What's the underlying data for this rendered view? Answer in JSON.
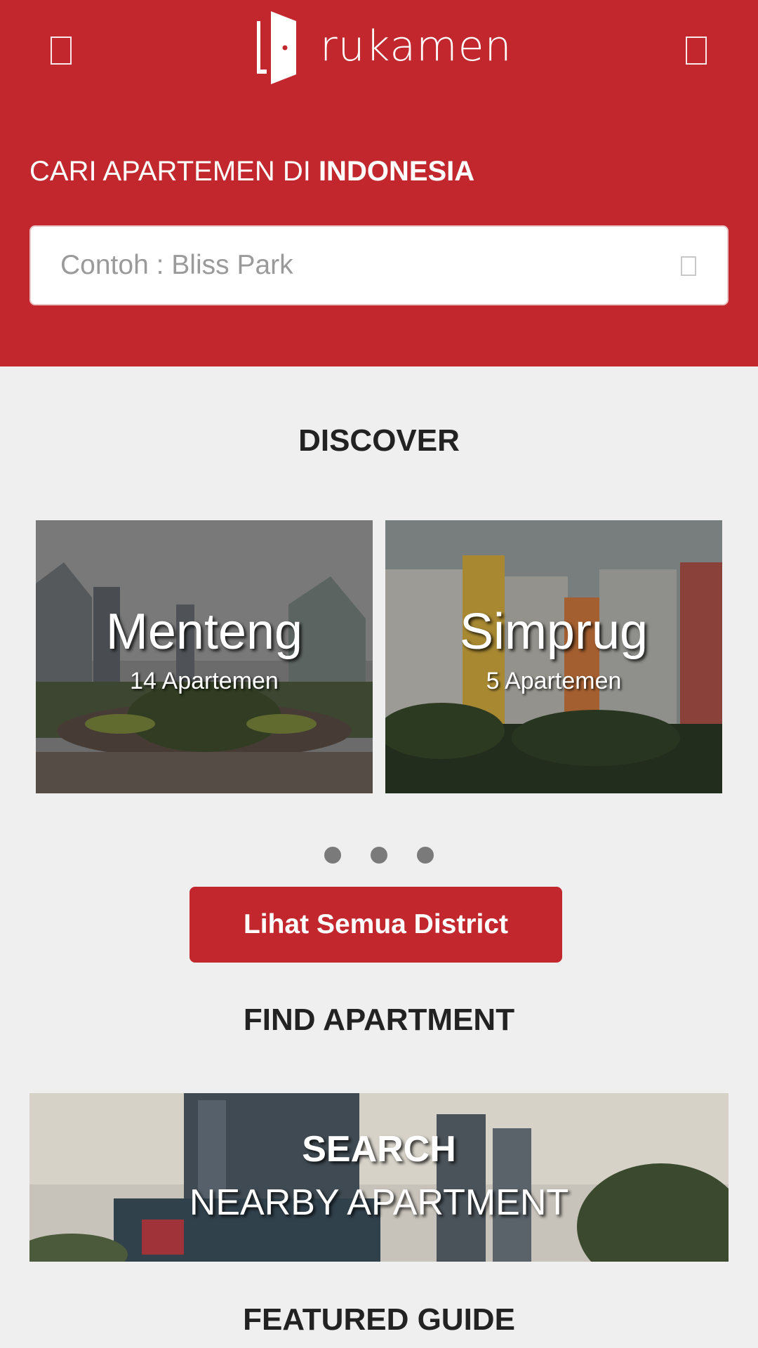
{
  "header": {
    "brand_name": "rukamen",
    "search_heading_prefix": "CARI APARTEMEN DI ",
    "search_heading_emphasis": "INDONESIA",
    "search_placeholder": "Contoh : Bliss Park",
    "menu_icon": "menu-icon",
    "account_icon": "account-icon",
    "search_icon": "search-icon",
    "brand_color": "#c1272d"
  },
  "discover": {
    "title": "DISCOVER",
    "districts": [
      {
        "name": "Menteng",
        "count_label": "14 Apartemen"
      },
      {
        "name": "Simprug",
        "count_label": "5 Apartemen"
      }
    ],
    "carousel_pages": 3,
    "view_all_label": "Lihat Semua District"
  },
  "find_apartment": {
    "title": "FIND APARTMENT",
    "banner_line1": "SEARCH",
    "banner_line2": "NEARBY APARTMENT"
  },
  "featured_guide": {
    "title": "FEATURED GUIDE"
  }
}
